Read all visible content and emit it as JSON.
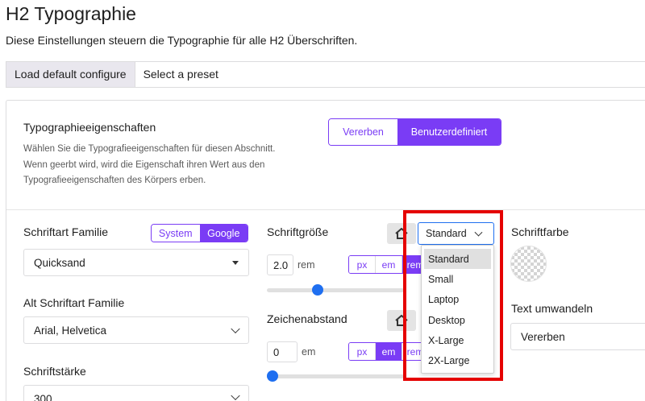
{
  "page": {
    "title": "H2 Typographie",
    "description": "Diese Einstellungen steuern die Typographie für alle H2 Überschriften."
  },
  "toolbar": {
    "load_default": "Load default configure",
    "select_preset": "Select a preset"
  },
  "typography_section": {
    "title": "Typographieeigenschaften",
    "help": "Wählen Sie die Typografieeigenschaften für diesen Abschnitt. Wenn geerbt wird, wird die Eigenschaft ihren Wert aus den Typografieeigenschaften des Körpers erben.",
    "inherit_label": "Vererben",
    "custom_label": "Benutzerdefiniert",
    "selected": "Benutzerdefiniert"
  },
  "font_family": {
    "label": "Schriftart Familie",
    "source_system": "System",
    "source_google": "Google",
    "source_selected": "Google",
    "value": "Quicksand"
  },
  "alt_font_family": {
    "label": "Alt Schriftart Familie",
    "value": "Arial, Helvetica"
  },
  "font_weight": {
    "label": "Schriftstärke",
    "value": "300"
  },
  "font_size": {
    "label": "Schriftgröße",
    "value": "2.0",
    "unit": "rem",
    "units": [
      "px",
      "em",
      "rem"
    ],
    "selected_unit": "rem",
    "slider_fraction": 0.36
  },
  "letter_spacing": {
    "label": "Zeichenabstand",
    "value": "0",
    "unit": "em",
    "units": [
      "px",
      "em",
      "rem"
    ],
    "selected_unit": "em",
    "slider_fraction": 0.0
  },
  "device_select": {
    "value": "Standard",
    "options": [
      "Standard",
      "Small",
      "Laptop",
      "Desktop",
      "X-Large",
      "2X-Large"
    ],
    "selected_index": 0
  },
  "font_color": {
    "label": "Schriftfarbe"
  },
  "text_transform": {
    "label": "Text umwandeln",
    "value": "Vererben"
  },
  "colors": {
    "accent": "#7a3cf5",
    "slider_thumb": "#1f6ff0",
    "highlight": "#e50000"
  }
}
